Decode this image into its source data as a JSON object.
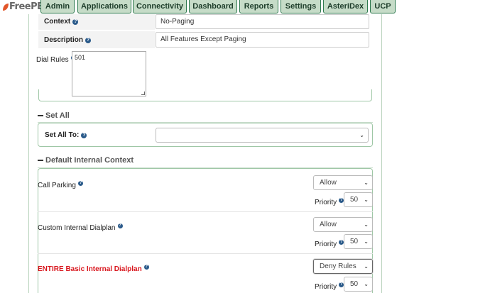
{
  "logo": {
    "text": "FreePBX",
    "pre_text": "fr"
  },
  "nav": {
    "tabs": [
      {
        "label": "Admin"
      },
      {
        "label": "Applications"
      },
      {
        "label": "Connectivity"
      },
      {
        "label": "Dashboard"
      },
      {
        "label": "Reports"
      },
      {
        "label": "Settings"
      },
      {
        "label": "AsteriDex"
      },
      {
        "label": "UCP"
      }
    ]
  },
  "form": {
    "context_label": "Context",
    "context_value": "No-Paging",
    "description_label": "Description",
    "description_value": "All Features Except Paging",
    "dial_rules_label": "Dial Rules",
    "dial_rules_value": "501"
  },
  "set_all": {
    "section_title": "Set All",
    "label": "Set All To:",
    "value": ""
  },
  "default_internal": {
    "section_title": "Default Internal Context",
    "rows": [
      {
        "label": "Call Parking",
        "value": "Allow",
        "priority_label": "Priority",
        "priority": "50"
      },
      {
        "label": "Custom Internal Dialplan",
        "value": "Allow",
        "priority_label": "Priority",
        "priority": "50"
      },
      {
        "label": "ENTIRE Basic Internal Dialplan",
        "value": "Deny Rules",
        "priority_label": "Priority",
        "priority": "50"
      }
    ]
  },
  "icons": {
    "help": "question-circle-icon",
    "dropdown": "chevron-down-icon",
    "collapse": "minus-icon"
  },
  "colors": {
    "nav_bg": "#c6dcc8",
    "nav_border": "#2f7a4f",
    "red_label": "#d9171e",
    "help_icon": "#2a5a8a"
  }
}
